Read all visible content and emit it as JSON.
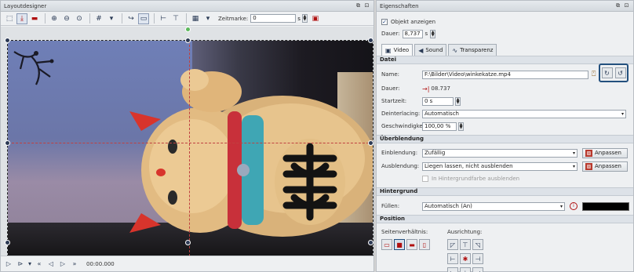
{
  "layout_panel": {
    "title": "Layoutdesigner",
    "window_buttons": [
      "⧉",
      "⊡"
    ],
    "toolbar": {
      "zeitmarke_label": "Zeitmarke:",
      "zeitmarke_value": "0",
      "unit": "s"
    },
    "playback": {
      "time": "00:00.000"
    }
  },
  "props_panel": {
    "title": "Eigenschaften",
    "window_buttons": [
      "⧉",
      "⊡"
    ],
    "show_object_label": "Objekt anzeigen",
    "show_object_checked": true,
    "duration_label": "Dauer:",
    "duration_value": "8,737",
    "duration_unit": "s",
    "tabs": [
      {
        "label": "Video",
        "icon": "film-icon"
      },
      {
        "label": "Sound",
        "icon": "speaker-icon"
      },
      {
        "label": "Transparenz",
        "icon": "wave-icon"
      }
    ],
    "section_file": "Datei",
    "name_label": "Name:",
    "name_value": "F:\\Bilder\\Video\\winkekatze.mp4",
    "file_duration_label": "Dauer:",
    "file_duration_value": "08.737",
    "start_label": "Startzeit:",
    "start_value": "0 s",
    "deinterlace_label": "Deinterlacing:",
    "deinterlace_value": "Automatisch",
    "speed_label": "Geschwindigkeit:",
    "speed_value": "100,00 %",
    "section_transition": "Überblendung",
    "fade_in_label": "Einblendung:",
    "fade_in_value": "Zufällig",
    "fade_in_button": "Anpassen",
    "fade_out_label": "Ausblendung:",
    "fade_out_value": "Liegen lassen, nicht ausblenden",
    "fade_out_button": "Anpassen",
    "bg_fade_label": "In Hintergrundfarbe ausblenden",
    "section_background": "Hintergrund",
    "fill_label": "Füllen:",
    "fill_value": "Automatisch (An)",
    "fill_color": "#000000",
    "section_position": "Position",
    "aspect_label": "Seitenverhältnis:",
    "align_label": "Ausrichtung:"
  }
}
